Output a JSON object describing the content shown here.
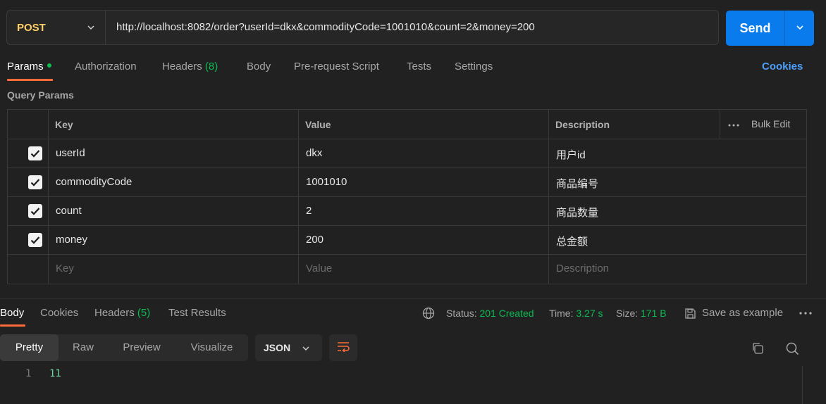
{
  "request": {
    "method": "POST",
    "url": "http://localhost:8082/order?userId=dkx&commodityCode=1001010&count=2&money=200",
    "send_label": "Send"
  },
  "tabs": {
    "params": "Params",
    "authorization": "Authorization",
    "headers": "Headers",
    "headers_count": "(8)",
    "body": "Body",
    "prerequest": "Pre-request Script",
    "tests": "Tests",
    "settings": "Settings",
    "cookies": "Cookies"
  },
  "query_params": {
    "title": "Query Params",
    "columns": {
      "key": "Key",
      "value": "Value",
      "description": "Description",
      "bulk_edit": "Bulk Edit"
    },
    "rows": [
      {
        "checked": true,
        "key": "userId",
        "value": "dkx",
        "description": "用户id"
      },
      {
        "checked": true,
        "key": "commodityCode",
        "value": "1001010",
        "description": "商品编号"
      },
      {
        "checked": true,
        "key": "count",
        "value": "2",
        "description": "商品数量"
      },
      {
        "checked": true,
        "key": "money",
        "value": "200",
        "description": "总金额"
      }
    ],
    "placeholders": {
      "key": "Key",
      "value": "Value",
      "description": "Description"
    }
  },
  "response": {
    "tabs": {
      "body": "Body",
      "cookies": "Cookies",
      "headers": "Headers",
      "headers_count": "(5)",
      "test_results": "Test Results"
    },
    "status_label": "Status:",
    "status_value": "201 Created",
    "time_label": "Time:",
    "time_value": "3.27 s",
    "size_label": "Size:",
    "size_value": "171 B",
    "save_example": "Save as example",
    "view_modes": [
      "Pretty",
      "Raw",
      "Preview",
      "Visualize"
    ],
    "format": "JSON",
    "lines": [
      {
        "num": "1",
        "text": "11"
      }
    ]
  },
  "colors": {
    "accent": "#ff6c37",
    "send": "#097bed",
    "method": "#ffd166",
    "success": "#0cbb52",
    "link": "#4b9ef9",
    "background": "#212121"
  },
  "icons": [
    "chevron-down-icon",
    "globe-icon",
    "save-icon",
    "more-icon",
    "wrap-icon",
    "copy-icon",
    "search-icon",
    "check-icon"
  ]
}
